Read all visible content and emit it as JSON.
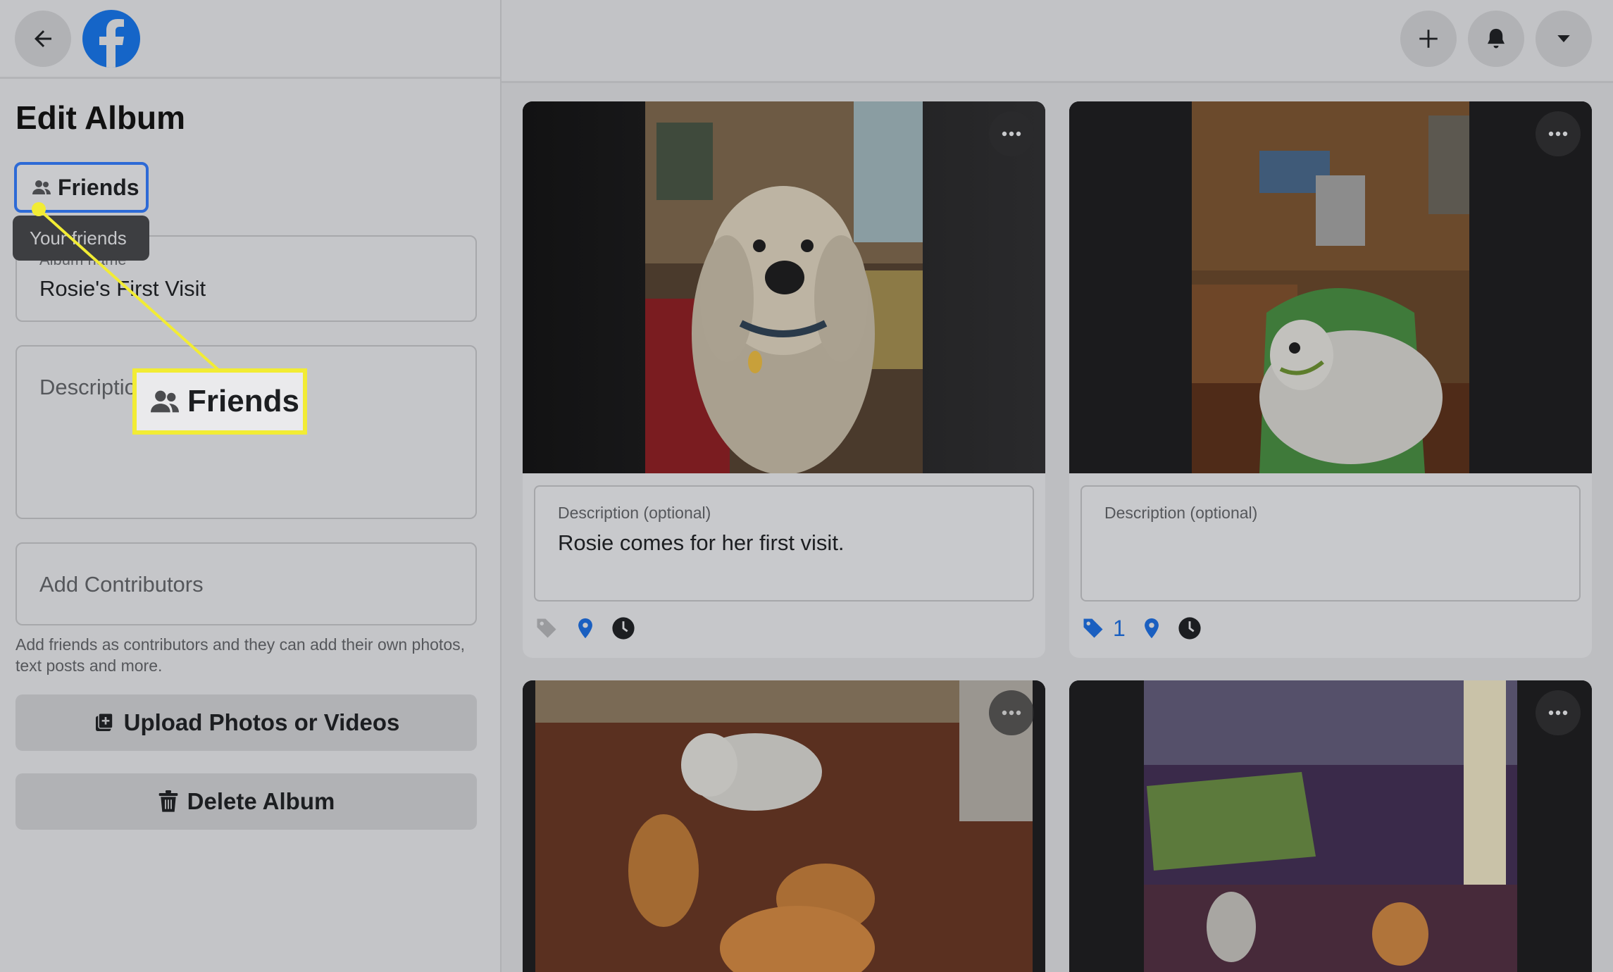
{
  "header": {
    "back_icon": "arrow-left-icon",
    "logo_icon": "facebook-logo-icon",
    "create_icon": "plus-icon",
    "notifications_icon": "bell-icon",
    "account_icon": "caret-down-icon"
  },
  "sidebar": {
    "title": "Edit Album",
    "privacy_button": {
      "label": "Friends",
      "icon": "friends-icon"
    },
    "privacy_tooltip": "Your friends",
    "album_name": {
      "label": "Album name",
      "value": "Rosie's First Visit"
    },
    "description": {
      "placeholder": "Description"
    },
    "contributors": {
      "placeholder": "Add Contributors"
    },
    "contributors_help": "Add friends as contributors and they can add their own photos, text posts and more.",
    "upload_button": {
      "label": "Upload Photos or Videos",
      "icon": "photo-add-icon"
    },
    "delete_button": {
      "label": "Delete Album",
      "icon": "trash-icon"
    }
  },
  "callout": {
    "label": "Friends",
    "icon": "friends-icon",
    "color": "#f2ec34"
  },
  "photos": [
    {
      "description_label": "Description (optional)",
      "description": "Rosie comes for her first visit.",
      "tag_count": "",
      "tag_icon": "tag-icon",
      "location_icon": "location-pin-icon",
      "time_icon": "clock-icon"
    },
    {
      "description_label": "Description (optional)",
      "description": "",
      "tag_count": "1",
      "tag_icon": "tag-icon",
      "location_icon": "location-pin-icon",
      "time_icon": "clock-icon"
    },
    {
      "more_icon": "more-horizontal-icon"
    },
    {
      "more_icon": "more-horizontal-icon"
    }
  ],
  "colors": {
    "accent_blue": "#1565c8",
    "highlight_yellow": "#f2ec34"
  }
}
